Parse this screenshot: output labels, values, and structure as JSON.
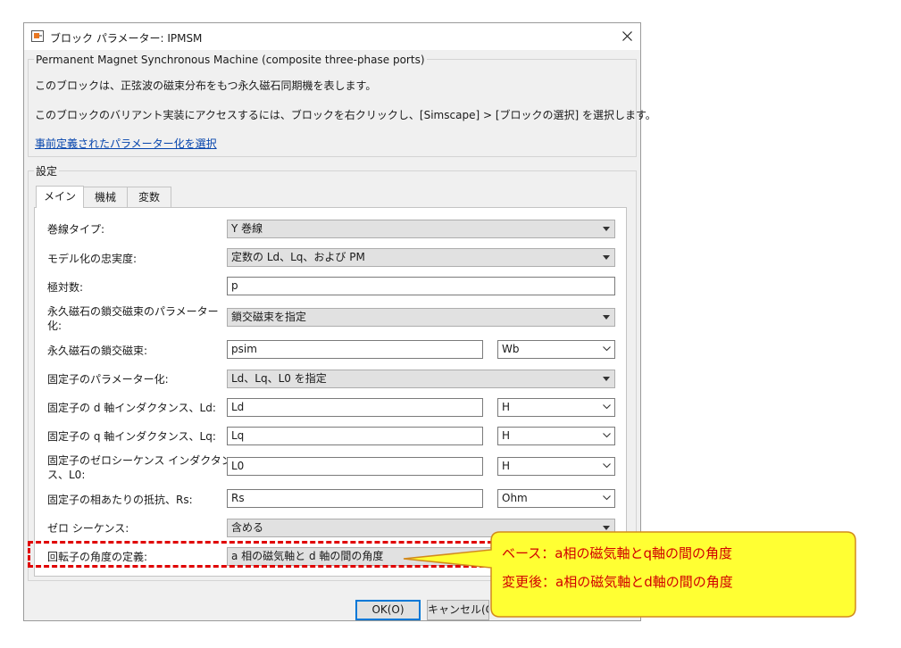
{
  "dialog": {
    "title": "ブロック パラメーター: IPMSM",
    "block_name": "Permanent Magnet Synchronous Machine (composite three-phase ports)",
    "description1": "このブロックは、正弦波の磁束分布をもつ永久磁石同期機を表します。",
    "description2": "このブロックのバリアント実装にアクセスするには、ブロックを右クリックし、[Simscape] > [ブロックの選択] を選択します。",
    "link": "事前定義されたパラメーター化を選択",
    "settings_label": "設定"
  },
  "tabs": [
    {
      "label": "メイン"
    },
    {
      "label": "機械"
    },
    {
      "label": "変数"
    }
  ],
  "params": {
    "winding_type": {
      "label": "巻線タイプ:",
      "value": "Y 巻線"
    },
    "fidelity": {
      "label": "モデル化の忠実度:",
      "value": "定数の Ld、Lq、および PM"
    },
    "pole_pairs": {
      "label": "極対数:",
      "value": "p"
    },
    "flux_param": {
      "label1": "永久磁石の鎖交磁束のパラメーター",
      "label2": "化:",
      "value": "鎖交磁束を指定"
    },
    "flux_linkage": {
      "label": "永久磁石の鎖交磁束:",
      "value": "psim",
      "unit": "Wb"
    },
    "stator_param": {
      "label": "固定子のパラメーター化:",
      "value": "Ld、Lq、L0 を指定"
    },
    "ld": {
      "label": "固定子の d 軸インダクタンス、Ld:",
      "value": "Ld",
      "unit": "H"
    },
    "lq": {
      "label": "固定子の q 軸インダクタンス、Lq:",
      "value": "Lq",
      "unit": "H"
    },
    "l0": {
      "label1": "固定子のゼロシーケンス インダクタン",
      "label2": "ス、L0:",
      "value": "L0",
      "unit": "H"
    },
    "rs": {
      "label": "固定子の相あたりの抵抗、Rs:",
      "value": "Rs",
      "unit": "Ohm"
    },
    "zero_seq": {
      "label": "ゼロ シーケンス:",
      "value": "含める"
    },
    "rotor_angle": {
      "label": "回転子の角度の定義:",
      "value": "a 相の磁気軸と d 軸の間の角度"
    }
  },
  "buttons": {
    "ok": "OK(O)",
    "cancel": "キャンセル(C"
  },
  "callout": {
    "line1": "ベース：a相の磁気軸とq軸の間の角度",
    "line2": "変更後：a相の磁気軸とd軸の間の角度"
  }
}
